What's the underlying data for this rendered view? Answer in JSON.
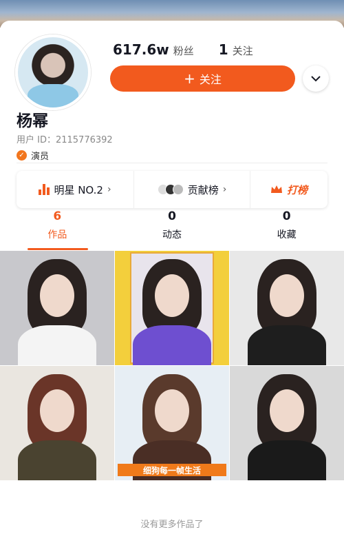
{
  "profile": {
    "followers_count": "617.6w",
    "followers_label": "粉丝",
    "following_count": "1",
    "following_label": "关注",
    "follow_button_label": "关注",
    "name": "杨幂",
    "user_id": "用户 ID：2115776392",
    "role": "演员"
  },
  "rank_card": {
    "star_rank": "明星 NO.2",
    "contribution_label": "贡献榜",
    "vote_label": "打榜"
  },
  "tabs": [
    {
      "count": "6",
      "label": "作品"
    },
    {
      "count": "0",
      "label": "动态"
    },
    {
      "count": "0",
      "label": "收藏"
    }
  ],
  "grid": {
    "caption_5": "细狗每一帧生活"
  },
  "footer": {
    "no_more_text": "没有更多作品了"
  },
  "colors": {
    "accent": "#f25a1e"
  }
}
